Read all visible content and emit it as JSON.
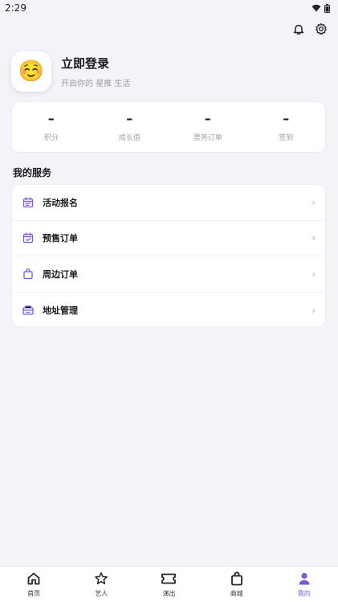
{
  "status_bar": {
    "time": "2:29"
  },
  "profile": {
    "avatar_emoji": "☺️",
    "title": "立即登录",
    "subtitle": "开启你的 星推 生活"
  },
  "stats": [
    {
      "value": "–",
      "label": "积分"
    },
    {
      "value": "–",
      "label": "成长值"
    },
    {
      "value": "–",
      "label": "票务订单"
    },
    {
      "value": "–",
      "label": "签到"
    }
  ],
  "services": {
    "title": "我的服务",
    "items": [
      {
        "label": "活动报名",
        "icon": "calendar-icon"
      },
      {
        "label": "预售订单",
        "icon": "calendar-check-icon"
      },
      {
        "label": "周边订单",
        "icon": "shopping-bag-icon"
      },
      {
        "label": "地址管理",
        "icon": "address-icon"
      }
    ]
  },
  "nav": [
    {
      "label": "首页",
      "icon": "home-icon",
      "active": false
    },
    {
      "label": "艺人",
      "icon": "star-icon",
      "active": false
    },
    {
      "label": "演出",
      "icon": "ticket-icon",
      "active": false
    },
    {
      "label": "商城",
      "icon": "shopping-bag-icon",
      "active": false
    },
    {
      "label": "我的",
      "icon": "user-icon",
      "active": true
    }
  ],
  "colors": {
    "accent": "#7b57e4",
    "background": "#f3f3f8"
  }
}
